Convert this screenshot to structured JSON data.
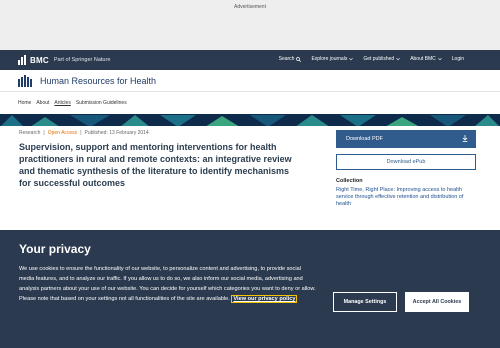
{
  "ad": {
    "label": "Advertisement"
  },
  "bmc": {
    "logo_text": "BMC",
    "springer_text": "Part of Springer Nature",
    "nav": [
      {
        "label": "Search",
        "icon": "search-icon"
      },
      {
        "label": "Explore journals",
        "icon": "chevron-down-icon"
      },
      {
        "label": "Get published",
        "icon": "chevron-down-icon"
      },
      {
        "label": "About BMC",
        "icon": "chevron-down-icon"
      },
      {
        "label": "Login",
        "icon": ""
      }
    ]
  },
  "journal": {
    "title": "Human Resources for Health"
  },
  "subnav": {
    "items": [
      "Home",
      "About",
      "Articles",
      "Submission Guidelines"
    ],
    "active": "Articles"
  },
  "article": {
    "type": "Research",
    "access": "Open Access",
    "published": "Published: 13 February 2014",
    "title": "Supervision, support and mentoring interventions for health practitioners in rural and remote contexts: an integrative review and thematic synthesis of the literature to identify mechanisms for successful outcomes"
  },
  "sidebar": {
    "download_pdf": "Download PDF",
    "download_epub": "Download ePub",
    "collection_heading": "Collection",
    "collection_link": "Right Time, Right Place: Improving access to health service through effective retention and distribution of health"
  },
  "privacy": {
    "title": "Your privacy",
    "text": "We use cookies to ensure the functionality of our website, to personalize content and advertising, to provide social media features, and to analyze our traffic. If you allow us to do so, we also inform our social media, advertising and analysis partners about your use of our website. You can decide for yourself which categories you want to deny or allow. Please note that based on your settings not all functionalities of the site are available.",
    "link": "View our privacy policy",
    "manage_label": "Manage Settings",
    "accept_label": "Accept All Cookies"
  },
  "colors": {
    "navy": "#2b3a4f",
    "accent_blue": "#305b8d",
    "open_access": "#e8700a",
    "focus_outline": "#f5c400"
  }
}
